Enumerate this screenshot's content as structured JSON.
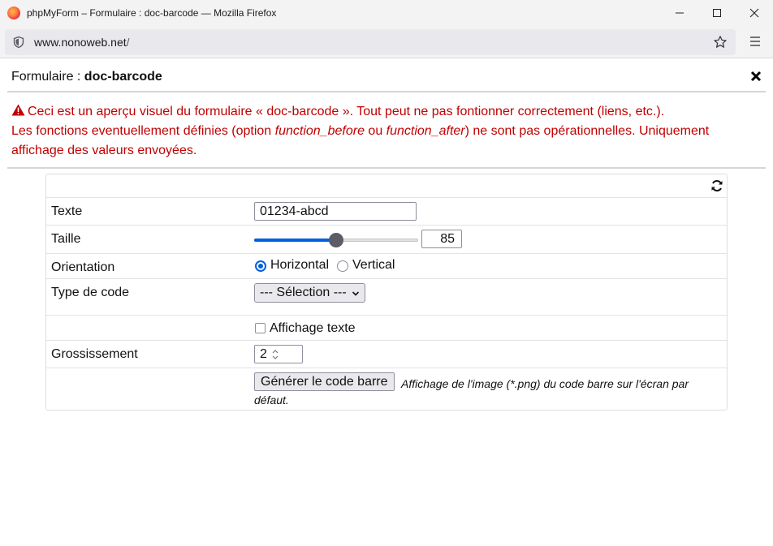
{
  "window": {
    "title": "phpMyForm – Formulaire : doc-barcode — Mozilla Firefox",
    "url_host": "www.nonoweb.net",
    "url_path": "/"
  },
  "form": {
    "title_prefix": "Formulaire : ",
    "title_name": "doc-barcode"
  },
  "warning": {
    "line1": "Ceci est un aperçu visuel du formulaire « doc-barcode ». Tout peut ne pas fontionner correctement (liens, etc.).",
    "line2_a": "Les fonctions eventuellement définies (option ",
    "line2_b": "function_before",
    "line2_c": " ou ",
    "line2_d": "function_after",
    "line2_e": ") ne sont pas opérationnelles. Uniquement affichage des valeurs envoyées."
  },
  "fields": {
    "texte": {
      "label": "Texte",
      "value": "01234-abcd"
    },
    "taille": {
      "label": "Taille",
      "value": "85",
      "slider_fraction": 0.5
    },
    "orientation": {
      "label": "Orientation",
      "options": [
        "Horizontal",
        "Vertical"
      ],
      "selected": "Horizontal"
    },
    "type_code": {
      "label": "Type de code",
      "selected": "--- Sélection ---"
    },
    "affichage": {
      "label": "Affichage texte",
      "checked": false
    },
    "grossissement": {
      "label": "Grossissement",
      "value": "2"
    },
    "generate": {
      "button": "Générer le code barre",
      "hint": "Affichage de l'image (*.png) du code barre sur l'écran par défaut."
    }
  },
  "colors": {
    "warning": "#c00000",
    "accent": "#0060df"
  }
}
